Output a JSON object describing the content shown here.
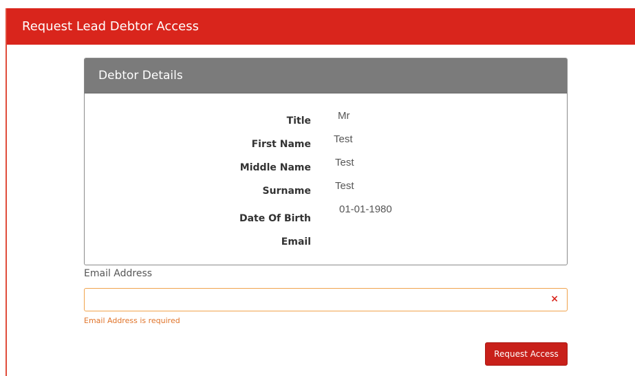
{
  "header": {
    "title": "Request Lead Debtor Access"
  },
  "debtor_card": {
    "title": "Debtor Details",
    "fields": [
      {
        "label": "Title",
        "value": "Mr"
      },
      {
        "label": "First Name",
        "value": "Test"
      },
      {
        "label": "Middle Name",
        "value": "Test"
      },
      {
        "label": "Surname",
        "value": "Test"
      },
      {
        "label": "Date Of Birth",
        "value": "01-01-1980"
      },
      {
        "label": "Email",
        "value": ""
      }
    ]
  },
  "email_form": {
    "label": "Email Address",
    "value": "",
    "error": "Email Address is required",
    "clear_icon": "×"
  },
  "actions": {
    "request_label": "Request Access"
  },
  "colors": {
    "brand_red": "#d9251c",
    "card_header_gray": "#7b7b7b",
    "error_orange": "#e0742a",
    "input_error_border": "#f0a24a"
  }
}
